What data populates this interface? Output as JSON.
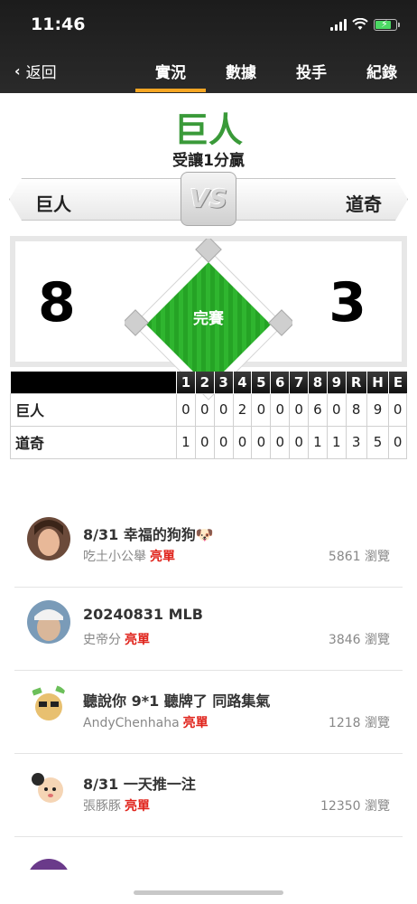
{
  "status_bar": {
    "time": "11:46"
  },
  "nav": {
    "back_label": "返回",
    "tabs": [
      {
        "label": "實況",
        "active": true
      },
      {
        "label": "數據",
        "active": false
      },
      {
        "label": "投手",
        "active": false
      },
      {
        "label": "紀錄",
        "active": false
      }
    ]
  },
  "game": {
    "winner": "巨人",
    "subtitle": "受讓1分贏",
    "vs_label": "VS",
    "away_team": "巨人",
    "home_team": "道奇",
    "away_score": "8",
    "home_score": "3",
    "status": "完賽"
  },
  "linescore": {
    "headers": [
      "1",
      "2",
      "3",
      "4",
      "5",
      "6",
      "7",
      "8",
      "9",
      "R",
      "H",
      "E"
    ],
    "rows": [
      {
        "team": "巨人",
        "cells": [
          "0",
          "0",
          "0",
          "2",
          "0",
          "0",
          "0",
          "6",
          "0",
          "8",
          "9",
          "0"
        ]
      },
      {
        "team": "道奇",
        "cells": [
          "1",
          "0",
          "0",
          "0",
          "0",
          "0",
          "0",
          "1",
          "1",
          "3",
          "5",
          "0"
        ]
      }
    ]
  },
  "feed": [
    {
      "title": "8/31 幸福的狗狗🐶",
      "author": "吃土小公舉",
      "tag": "亮單",
      "views": "5861 瀏覽"
    },
    {
      "title": "20240831 MLB",
      "author": "史帝分",
      "tag": "亮單",
      "views": "3846 瀏覽"
    },
    {
      "title": "聽說你 9*1 聽牌了 同路集氣",
      "author": "AndyChenhaha",
      "tag": "亮單",
      "views": "1218 瀏覽"
    },
    {
      "title": "8/31 一天推一注",
      "author": "張豚豚",
      "tag": "亮單",
      "views": "12350 瀏覽"
    }
  ],
  "colors": {
    "accent": "#f5a623",
    "winner": "#3a9a39",
    "field": "#2bb02b",
    "tag": "#e0241c"
  }
}
